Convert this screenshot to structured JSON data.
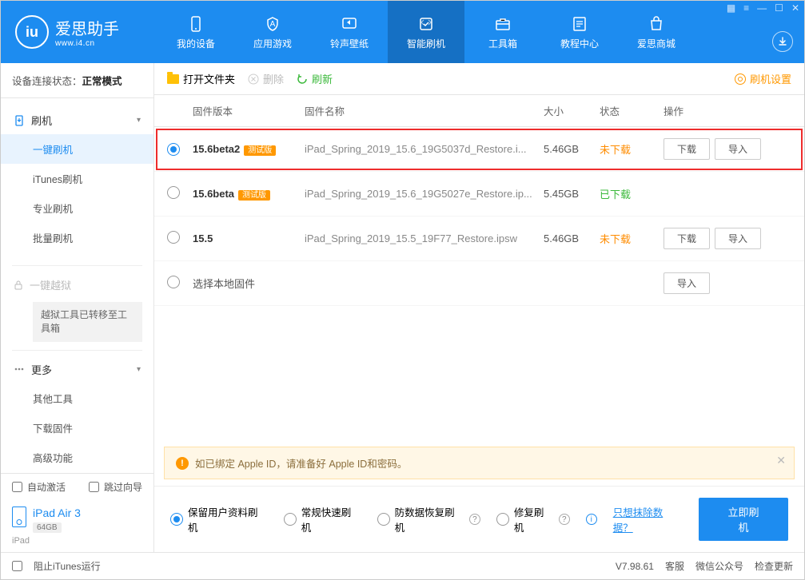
{
  "app": {
    "name_cn": "爱思助手",
    "name_en": "www.i4.cn"
  },
  "nav": {
    "items": [
      {
        "label": "我的设备"
      },
      {
        "label": "应用游戏"
      },
      {
        "label": "铃声壁纸"
      },
      {
        "label": "智能刷机"
      },
      {
        "label": "工具箱"
      },
      {
        "label": "教程中心"
      },
      {
        "label": "爱思商城"
      }
    ],
    "active_index": 3
  },
  "status": {
    "prefix": "设备连接状态：",
    "mode": "正常模式"
  },
  "sidebar": {
    "flash_group": {
      "head": "刷机",
      "items": [
        {
          "label": "一键刷机",
          "active": true
        },
        {
          "label": "iTunes刷机"
        },
        {
          "label": "专业刷机"
        },
        {
          "label": "批量刷机"
        }
      ]
    },
    "jailbreak": {
      "head": "一键越狱",
      "note": "越狱工具已转移至工具箱"
    },
    "more_group": {
      "head": "更多",
      "items": [
        {
          "label": "其他工具"
        },
        {
          "label": "下载固件"
        },
        {
          "label": "高级功能"
        }
      ]
    }
  },
  "bottom_checks": {
    "auto_activate": "自动激活",
    "skip_guide": "跳过向导"
  },
  "device": {
    "name": "iPad Air 3",
    "capacity": "64GB",
    "type": "iPad"
  },
  "toolbar": {
    "open_folder": "打开文件夹",
    "delete": "删除",
    "refresh": "刷新",
    "settings": "刷机设置"
  },
  "table": {
    "headers": {
      "version": "固件版本",
      "name": "固件名称",
      "size": "大小",
      "status": "状态",
      "ops": "操作"
    },
    "rows": [
      {
        "selected": true,
        "highlight": true,
        "version": "15.6beta2",
        "beta": true,
        "name": "iPad_Spring_2019_15.6_19G5037d_Restore.i...",
        "size": "5.46GB",
        "status": "未下载",
        "status_class": "not",
        "show_dl": true
      },
      {
        "selected": false,
        "version": "15.6beta",
        "beta": true,
        "name": "iPad_Spring_2019_15.6_19G5027e_Restore.ip...",
        "size": "5.45GB",
        "status": "已下载",
        "status_class": "done",
        "show_dl": false
      },
      {
        "selected": false,
        "version": "15.5",
        "beta": false,
        "name": "iPad_Spring_2019_15.5_19F77_Restore.ipsw",
        "size": "5.46GB",
        "status": "未下载",
        "status_class": "not",
        "show_dl": true
      }
    ],
    "local_row": "选择本地固件",
    "beta_tag": "测试版",
    "btn_download": "下载",
    "btn_import": "导入"
  },
  "warning": "如已绑定 Apple ID，请准备好 Apple ID和密码。",
  "flash_options": {
    "opts": [
      {
        "label": "保留用户资料刷机",
        "checked": true
      },
      {
        "label": "常规快速刷机"
      },
      {
        "label": "防数据恢复刷机",
        "help": true
      },
      {
        "label": "修复刷机",
        "help": true
      }
    ],
    "erase_link": "只想抹除数据？",
    "flash_btn": "立即刷机"
  },
  "footer": {
    "block_itunes": "阻止iTunes运行",
    "version": "V7.98.61",
    "links": [
      "客服",
      "微信公众号",
      "检查更新"
    ]
  }
}
